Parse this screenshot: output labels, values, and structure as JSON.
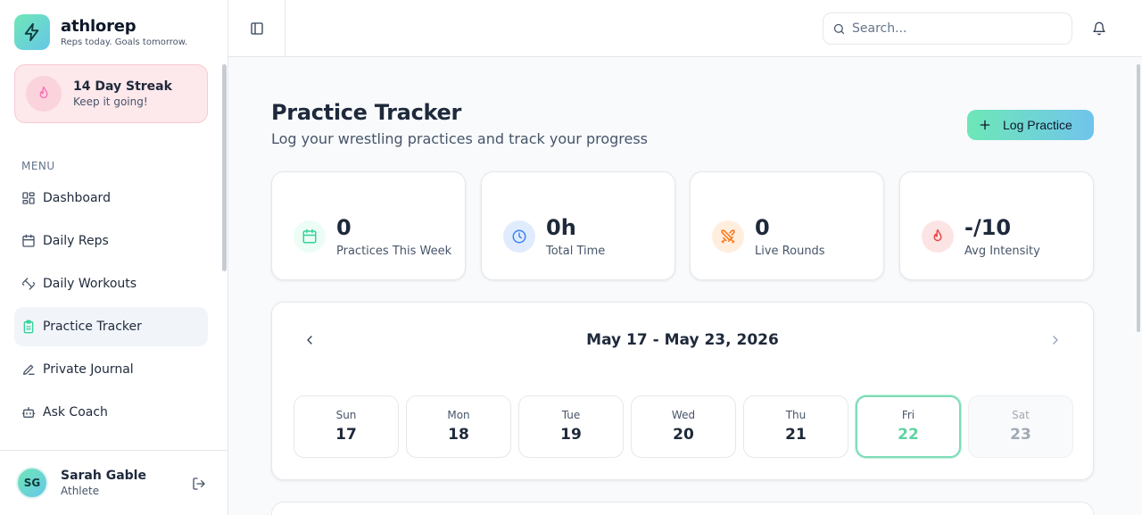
{
  "brand": {
    "name": "athlorep",
    "tagline": "Reps today. Goals tomorrow."
  },
  "streak": {
    "title": "14 Day Streak",
    "subtitle": "Keep it going!"
  },
  "sidebar": {
    "menu_label": "MENU",
    "items": [
      {
        "label": "Dashboard",
        "icon": "dashboard-icon"
      },
      {
        "label": "Daily Reps",
        "icon": "calendar-icon"
      },
      {
        "label": "Daily Workouts",
        "icon": "dumbbell-icon"
      },
      {
        "label": "Practice Tracker",
        "icon": "clipboard-icon",
        "active": true
      },
      {
        "label": "Private Journal",
        "icon": "pen-icon"
      },
      {
        "label": "Ask Coach",
        "icon": "bot-icon"
      }
    ]
  },
  "user": {
    "initials": "SG",
    "name": "Sarah Gable",
    "role": "Athlete"
  },
  "header": {
    "search_placeholder": "Search..."
  },
  "page": {
    "title": "Practice Tracker",
    "subtitle": "Log your wrestling practices and track your progress",
    "log_button": "Log Practice"
  },
  "stats": [
    {
      "value": "0",
      "label": "Practices This Week",
      "icon": "calendar-icon",
      "color": "#34d399"
    },
    {
      "value": "0h",
      "label": "Total Time",
      "icon": "clock-icon",
      "color": "#3b82f6"
    },
    {
      "value": "0",
      "label": "Live Rounds",
      "icon": "swords-icon",
      "color": "#f97316"
    },
    {
      "value": "-/10",
      "label": "Avg Intensity",
      "icon": "flame-icon",
      "color": "#ef4444"
    }
  ],
  "calendar": {
    "range": "May 17 - May 23, 2026",
    "days": [
      {
        "name": "Sun",
        "num": "17"
      },
      {
        "name": "Mon",
        "num": "18"
      },
      {
        "name": "Tue",
        "num": "19"
      },
      {
        "name": "Wed",
        "num": "20"
      },
      {
        "name": "Thu",
        "num": "21"
      },
      {
        "name": "Fri",
        "num": "22",
        "selected": true
      },
      {
        "name": "Sat",
        "num": "23",
        "future": true
      }
    ]
  },
  "colors": {
    "accent_start": "#6ee7b7",
    "accent_end": "#70c4ec",
    "streak_bg": "#fde8ec"
  }
}
